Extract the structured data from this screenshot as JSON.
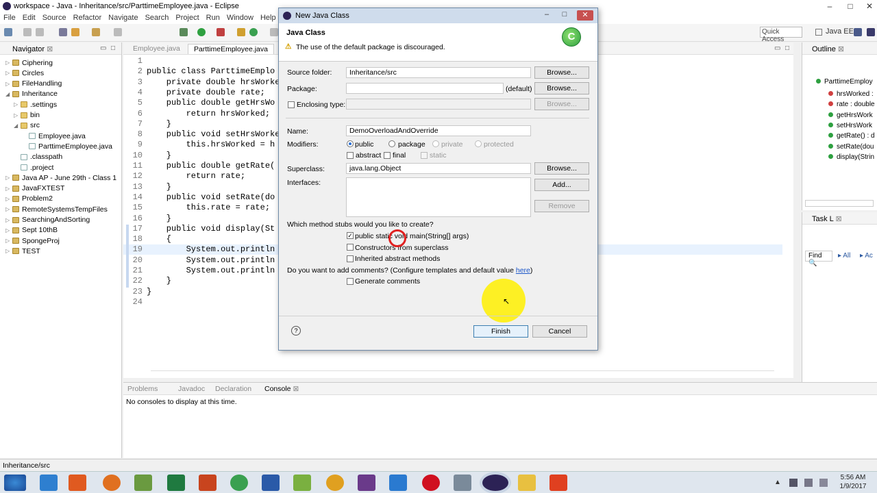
{
  "window": {
    "title": "workspace - Java - Inheritance/src/ParttimeEmployee.java - Eclipse"
  },
  "menu": [
    "File",
    "Edit",
    "Source",
    "Refactor",
    "Navigate",
    "Search",
    "Project",
    "Run",
    "Window",
    "Help"
  ],
  "toolbar": {
    "quick_access": "Quick Access",
    "perspective": "Java EE"
  },
  "navigator": {
    "title": "Navigator",
    "items": [
      {
        "label": "Ciphering",
        "level": 0,
        "kind": "project",
        "arrow": "▷"
      },
      {
        "label": "Circles",
        "level": 0,
        "kind": "project",
        "arrow": "▷"
      },
      {
        "label": "FileHandling",
        "level": 0,
        "kind": "project",
        "arrow": "▷"
      },
      {
        "label": "Inheritance",
        "level": 0,
        "kind": "project",
        "arrow": "◢"
      },
      {
        "label": ".settings",
        "level": 1,
        "kind": "folder",
        "arrow": "▷"
      },
      {
        "label": "bin",
        "level": 1,
        "kind": "folder",
        "arrow": "▷"
      },
      {
        "label": "src",
        "level": 1,
        "kind": "folder",
        "arrow": "◢"
      },
      {
        "label": "Employee.java",
        "level": 2,
        "kind": "file",
        "arrow": ""
      },
      {
        "label": "ParttimeEmployee.java",
        "level": 2,
        "kind": "file",
        "arrow": ""
      },
      {
        "label": ".classpath",
        "level": 1,
        "kind": "file",
        "arrow": ""
      },
      {
        "label": ".project",
        "level": 1,
        "kind": "file",
        "arrow": ""
      },
      {
        "label": "Java AP - June 29th - Class 1",
        "level": 0,
        "kind": "project",
        "arrow": "▷"
      },
      {
        "label": "JavaFXTEST",
        "level": 0,
        "kind": "project",
        "arrow": "▷"
      },
      {
        "label": "Problem2",
        "level": 0,
        "kind": "project",
        "arrow": "▷"
      },
      {
        "label": "RemoteSystemsTempFiles",
        "level": 0,
        "kind": "project",
        "arrow": "▷"
      },
      {
        "label": "SearchingAndSorting",
        "level": 0,
        "kind": "project",
        "arrow": "▷"
      },
      {
        "label": "Sept 10thB",
        "level": 0,
        "kind": "project",
        "arrow": "▷"
      },
      {
        "label": "SpongeProj",
        "level": 0,
        "kind": "project",
        "arrow": "▷"
      },
      {
        "label": "TEST",
        "level": 0,
        "kind": "project",
        "arrow": "▷"
      }
    ]
  },
  "editor": {
    "tabs": [
      "Employee.java",
      "ParttimeEmployee.java"
    ],
    "line_numbers": [
      "1",
      "2",
      "3",
      "4",
      "5",
      "6",
      "7",
      "8",
      "9",
      "10",
      "11",
      "12",
      "13",
      "14",
      "15",
      "16",
      "17",
      "18",
      "19",
      "20",
      "21",
      "22",
      "23",
      "24"
    ],
    "lines": [
      "",
      "public class ParttimeEmplo",
      "    private double hrsWorke",
      "    private double rate;",
      "    public double getHrsWo",
      "        return hrsWorked;",
      "    }",
      "    public void setHrsWorke",
      "        this.hrsWorked = h",
      "    }",
      "    public double getRate(",
      "        return rate;",
      "    }",
      "    public void setRate(do",
      "        this.rate = rate;",
      "    }",
      "    public void display(St",
      "    {",
      "        System.out.println",
      "        System.out.println",
      "        System.out.println",
      "    }",
      "}",
      ""
    ]
  },
  "outline": {
    "title": "Outline",
    "class_name": "ParttimeEmploy",
    "members": [
      "hrsWorked : ",
      "rate : double",
      "getHrsWork",
      "setHrsWork",
      "getRate() : d",
      "setRate(dou",
      "display(Strin"
    ]
  },
  "tasklist": {
    "title": "Task L",
    "find": "Find",
    "all": "All",
    "ac": "Ac"
  },
  "console": {
    "tabs": [
      "Problems",
      "Javadoc",
      "Declaration",
      "Console"
    ],
    "message": "No consoles to display at this time."
  },
  "status": {
    "text": "Inheritance/src"
  },
  "dialog": {
    "title": "New Java Class",
    "heading": "Java Class",
    "warning": "The use of the default package is discouraged.",
    "source_folder_label": "Source folder:",
    "source_folder_value": "Inheritance/src",
    "package_label": "Package:",
    "package_default": "(default)",
    "enclosing_type_label": "Enclosing type:",
    "browse": "Browse...",
    "name_label": "Name:",
    "name_value": "DemoOverloadAndOverride",
    "modifiers_label": "Modifiers:",
    "modifiers": [
      "public",
      "package",
      "private",
      "protected"
    ],
    "modifiers2": [
      "abstract",
      "final",
      "static"
    ],
    "superclass_label": "Superclass:",
    "superclass_value": "java.lang.Object",
    "interfaces_label": "Interfaces:",
    "add": "Add...",
    "remove": "Remove",
    "stubs_question": "Which method stubs would you like to create?",
    "stubs": [
      "public static void main(String[] args)",
      "Constructors from superclass",
      "Inherited abstract methods"
    ],
    "comments_question": "Do you want to add comments? (Configure templates and default value ",
    "comments_link": "here",
    "comments_tail": ")",
    "generate_comments": "Generate comments",
    "finish": "Finish",
    "cancel": "Cancel"
  },
  "clock": {
    "time": "5:56 AM",
    "date": "1/9/2017"
  }
}
